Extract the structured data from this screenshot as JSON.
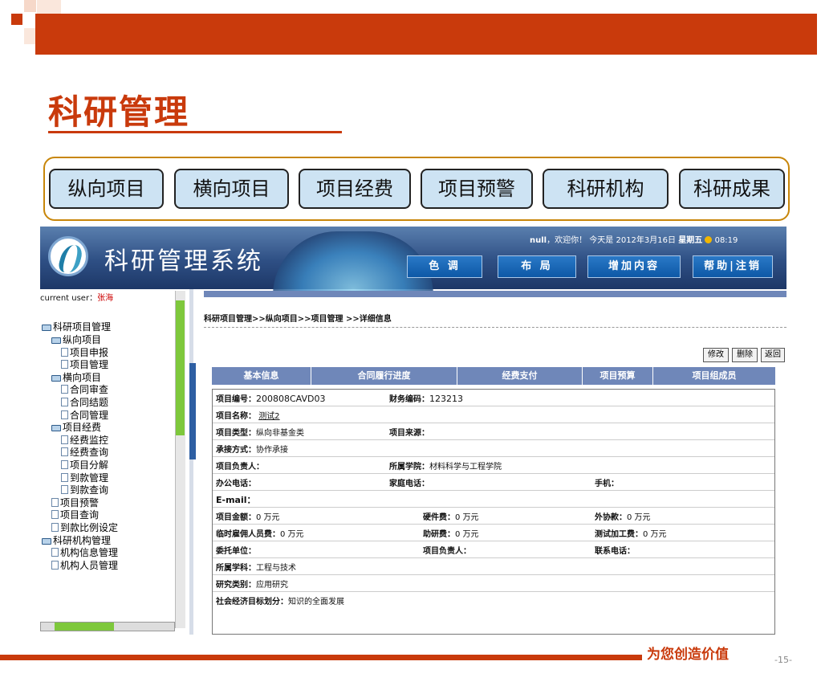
{
  "slide": {
    "title": "科研管理",
    "footer_slogan": "为您创造价值",
    "page_number": "-15-",
    "accent_color": "#c93a0c"
  },
  "nav_buttons": [
    "纵向项目",
    "横向项目",
    "项目经费",
    "项目预警",
    "科研机构",
    "科研成果"
  ],
  "app": {
    "title": "科研管理系统",
    "welcome": {
      "user": "null",
      "greeting": "，欢迎你！ 今天是",
      "date": "2012年3月16日",
      "weekday": "星期五",
      "time": "08:19"
    },
    "header_buttons": [
      "色 调",
      "布 局",
      "增加内容",
      "帮助|注销"
    ],
    "current_user_label": "current user：",
    "current_user": "张海",
    "sidebar_items": [
      "科研项目管理",
      "纵向项目",
      "项目申报",
      "项目管理",
      "横向项目",
      "合同审查",
      "合同结题",
      "合同管理",
      "项目经费",
      "经费监控",
      "经费查询",
      "项目分解",
      "到款管理",
      "到款查询",
      "项目预警",
      "项目查询",
      "到款比例设定",
      "科研机构管理",
      "机构信息管理",
      "机构人员管理"
    ],
    "breadcrumb": "科研项目管理>>纵向项目>>项目管理 >>详细信息",
    "action_buttons": [
      "修改",
      "删除",
      "返回"
    ],
    "tabs": [
      "基本信息",
      "合同履行进度",
      "经费支付",
      "项目预算",
      "项目组成员"
    ],
    "fields": {
      "project_no_k": "项目编号：",
      "project_no_v": "200808CAVD03",
      "finance_no_k": "财务编码：",
      "finance_no_v": "123213",
      "name_k": "项目名称：",
      "name_v": "测试2",
      "type_k": "项目类型：",
      "type_v": "纵向非基金类",
      "source_k": "项目来源：",
      "mode_k": "承接方式：",
      "mode_v": "协作承接",
      "leader_k": "项目负责人：",
      "college_k": "所属学院：",
      "college_v": "材料科学与工程学院",
      "office_k": "办公电话：",
      "home_k": "家庭电话：",
      "mobile_k": "手机：",
      "email_k": "E-mail：",
      "total_k": "项目金额：",
      "total_v": "0 万元",
      "hw_k": "硬件费：",
      "hw_v": "0 万元",
      "outsource_k": "外协款：",
      "outsource_v": "0 万元",
      "temp_k": "临时雇佣人员费：",
      "temp_v": "0 万元",
      "assist_k": "助研费：",
      "assist_v": "0 万元",
      "test_k": "测试加工费：",
      "test_v": "0 万元",
      "client_k": "委托单位：",
      "pleader_k": "项目负责人：",
      "contact_k": "联系电话：",
      "subject_k": "所属学科：",
      "subject_v": "工程与技术",
      "research_k": "研究类别：",
      "research_v": "应用研究",
      "goal_k": "社会经济目标划分：",
      "goal_v": "知识的全面发展"
    }
  }
}
